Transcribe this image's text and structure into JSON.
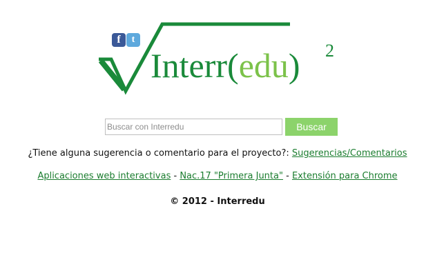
{
  "logo": {
    "brand_text": "Interr(edu)",
    "brand_open": "Interr",
    "brand_paren_open": "(",
    "brand_inner": "edu",
    "brand_paren_close": ")",
    "superscript": "2",
    "colors": {
      "primary": "#1a8a3a",
      "accent": "#7cc24a"
    }
  },
  "social": {
    "facebook_icon": "facebook-icon",
    "facebook_glyph": "f",
    "twitter_icon": "twitter-icon",
    "twitter_glyph": "t"
  },
  "search": {
    "placeholder": "Buscar con Interredu",
    "value": "",
    "button_label": "Buscar"
  },
  "feedback": {
    "text": "¿Tiene alguna sugerencia o comentario para el proyecto?: ",
    "link_label": "Sugerencias/Comentarios"
  },
  "links": {
    "apps_label": "Aplicaciones web interactivas",
    "sep1": " - ",
    "nac_label": "Nac.17 \"Primera Junta\"",
    "sep2": " - ",
    "chrome_label": "Extensión para Chrome"
  },
  "footer": {
    "copyright": "© 2012 - Interredu"
  }
}
